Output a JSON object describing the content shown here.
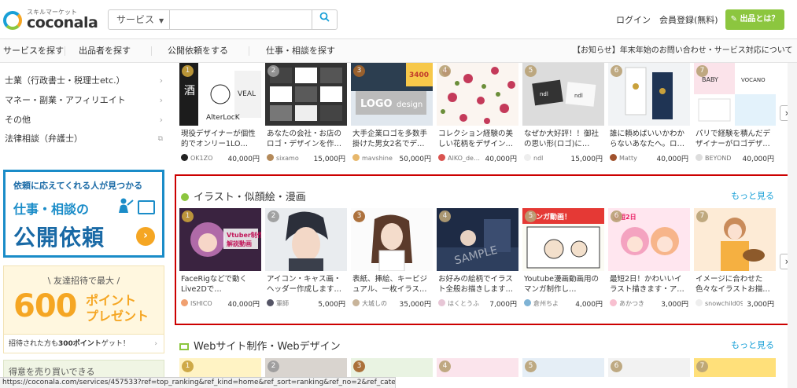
{
  "header": {
    "logo_sub": "スキルマーケット",
    "logo_text": "coconala",
    "search_category": "サービス",
    "search_placeholder": "",
    "login": "ログイン",
    "register": "会員登録(無料)",
    "cta_button": "出品とは？"
  },
  "nav": {
    "items": [
      "サービスを探す",
      "出品者を探す",
      "公開依頼をする",
      "仕事・相談を探す"
    ],
    "notice": "【お知らせ】年末年始のお問い合わせ・サービス対応について"
  },
  "sidebar": {
    "categories": [
      "士業（行政書士・税理士etc.）",
      "マネー・副業・アフィリエイト",
      "その他",
      "法律相談（弁護士）"
    ],
    "banner_request": {
      "top": "依頼に応えてくれる人が見つかる",
      "mid": "仕事・相談の",
      "big": "公開依頼"
    },
    "banner_invite": {
      "top": "友達招待で最大",
      "num": "600",
      "pt_line1": "ポイント",
      "pt_line2": "プレゼント",
      "bottom_pre": "招待された方も",
      "bottom_strong": "300ポイント",
      "bottom_post": "ゲット！"
    },
    "banner_third": "得意を売り買いできる"
  },
  "row_top": {
    "cards": [
      {
        "rank": "1",
        "title": "現役デザイナーが個性的でオンリー1LO…",
        "user": "OK1ZO",
        "price": "40,000円"
      },
      {
        "rank": "2",
        "title": "あなたの会社・お店のロゴ・デザインを作…",
        "user": "sixamo",
        "price": "15,000円"
      },
      {
        "rank": "3",
        "title": "大手企業ロゴを多数手掛けた男女2名でデ…",
        "user": "mavshine",
        "price": "50,000円"
      },
      {
        "rank": "4",
        "title": "コレクション経験の美しい花柄をデザイン…",
        "user": "AIKO_de…",
        "price": "40,000円"
      },
      {
        "rank": "5",
        "title": "なぜか大好評！！御社の思い形(ロゴ)に…",
        "user": "ndl",
        "price": "15,000円"
      },
      {
        "rank": "6",
        "title": "誰に頼めばいいかわからないあなたへ。ロ…",
        "user": "Matty",
        "price": "40,000円"
      },
      {
        "rank": "7",
        "title": "パリで経験を積んだデザイナーがロゴデザ…",
        "user": "BEYOND",
        "price": "40,000円"
      }
    ]
  },
  "illust": {
    "title": "イラスト・似顔絵・漫画",
    "more": "もっと見る",
    "cards": [
      {
        "rank": "1",
        "title": "FaceRigなどで動くLive2Dで…",
        "user": "ISHICO",
        "price": "40,000円",
        "thumb_text": "Vtuber制作解説動画"
      },
      {
        "rank": "2",
        "title": "アイコン・キャス画・ヘッダー作成します…",
        "user": "軍師",
        "price": "5,000円"
      },
      {
        "rank": "3",
        "title": "表紙、挿絵、キービジュアル、一枚イラス…",
        "user": "大城しの",
        "price": "35,000円"
      },
      {
        "rank": "4",
        "title": "お好みの絵柄でイラスト全般お描きします…",
        "user": "はくとうふ",
        "price": "7,000円",
        "thumb_text": "SAMPLE"
      },
      {
        "rank": "5",
        "title": "Youtube漫画動画用のマンガ制作し…",
        "user": "倉州ちよ",
        "price": "4,000円",
        "thumb_text": "マンガ動画"
      },
      {
        "rank": "6",
        "title": "最短2日！かわいいイラスト描きます・ア…",
        "user": "あかつき",
        "price": "3,000円"
      },
      {
        "rank": "7",
        "title": "イメージに合わせた色々なイラストお描…",
        "user": "snowchild09",
        "price": "3,000円"
      }
    ]
  },
  "web": {
    "title": "Webサイト制作・Webデザイン",
    "more": "もっと見る"
  },
  "status_url": "https://coconala.com/services/457533?ref=top_ranking&ref_kind=home&ref_sort=ranking&ref_no=2&ref_category=9",
  "colors": {
    "brand_blue": "#19a0d7",
    "brand_green": "#8cc63f",
    "highlight_red": "#cc0000"
  }
}
